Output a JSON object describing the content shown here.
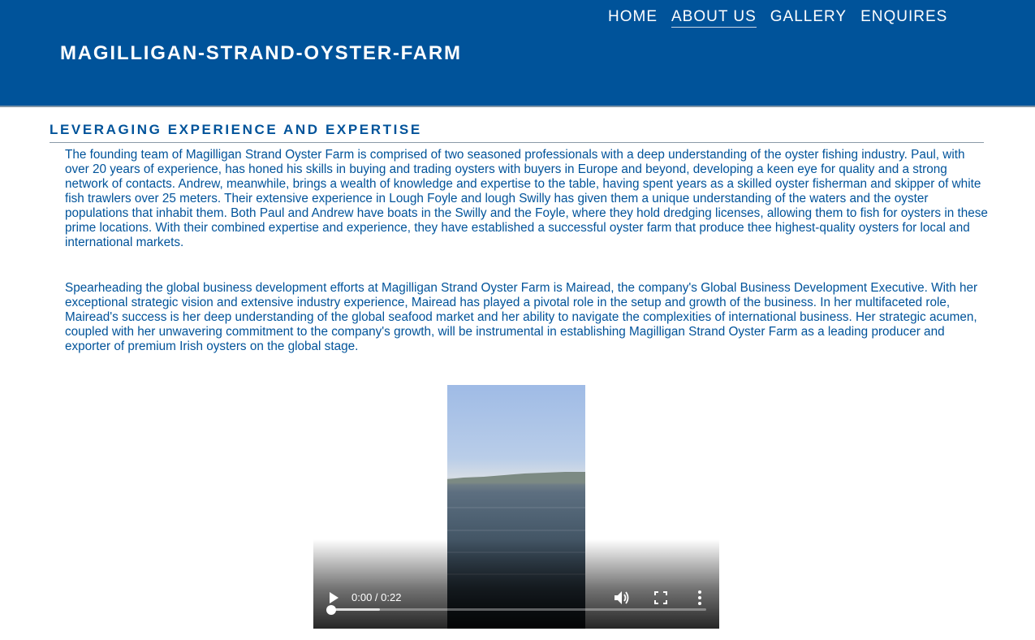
{
  "header": {
    "site_title": "MAGILLIGAN-STRAND-OYSTER-FARM",
    "nav": [
      {
        "label": "HOME",
        "active": false
      },
      {
        "label": "ABOUT US",
        "active": true
      },
      {
        "label": "GALLERY",
        "active": false
      },
      {
        "label": "ENQUIRES",
        "active": false
      }
    ]
  },
  "main": {
    "section_heading": "LEVERAGING EXPERIENCE AND EXPERTISE",
    "paragraphs": [
      "The founding team of Magilligan Strand Oyster Farm is comprised of two seasoned professionals with a deep understanding of the oyster fishing industry. Paul, with over 20 years of experience, has honed his skills in buying and trading oysters with buyers in Europe and beyond, developing a keen eye for quality and a strong network of contacts. Andrew, meanwhile, brings a wealth of knowledge and expertise to the table, having spent years as a skilled oyster fisherman and skipper of white fish trawlers over 25 meters. Their extensive experience in Lough Foyle and lough Swilly has given them a unique understanding of the waters and the oyster populations that inhabit them. Both Paul and Andrew have boats in the Swilly and the Foyle, where they hold dredging licenses, allowing them to fish for oysters in these prime locations. With their combined expertise and experience, they have established a successful oyster farm that produce thee highest-quality oysters for local and international markets.",
      "Spearheading the global business development efforts at Magilligan Strand Oyster Farm is Mairead, the company's Global Business Development Executive. With her exceptional strategic vision and extensive industry experience, Mairead has played a pivotal role in the setup and growth of the business. In her multifaceted role, Mairead's success is her deep understanding of the global seafood market and her ability to navigate the complexities of international business. Her strategic acumen, coupled with her unwavering commitment to the company's growth, will be instrumental in establishing Magilligan Strand Oyster Farm as a leading producer and exporter of premium Irish oysters on the global stage."
    ]
  },
  "video": {
    "time_display": "0:00 / 0:22",
    "progress_fraction": 0.0,
    "buffered_fraction": 0.13,
    "icons": {
      "play": "play-icon",
      "volume": "volume-icon",
      "fullscreen": "fullscreen-icon",
      "menu": "more-vertical-icon"
    }
  },
  "colors": {
    "brand_blue": "#00539a",
    "text_blue": "#00539a",
    "background": "#ffffff"
  }
}
